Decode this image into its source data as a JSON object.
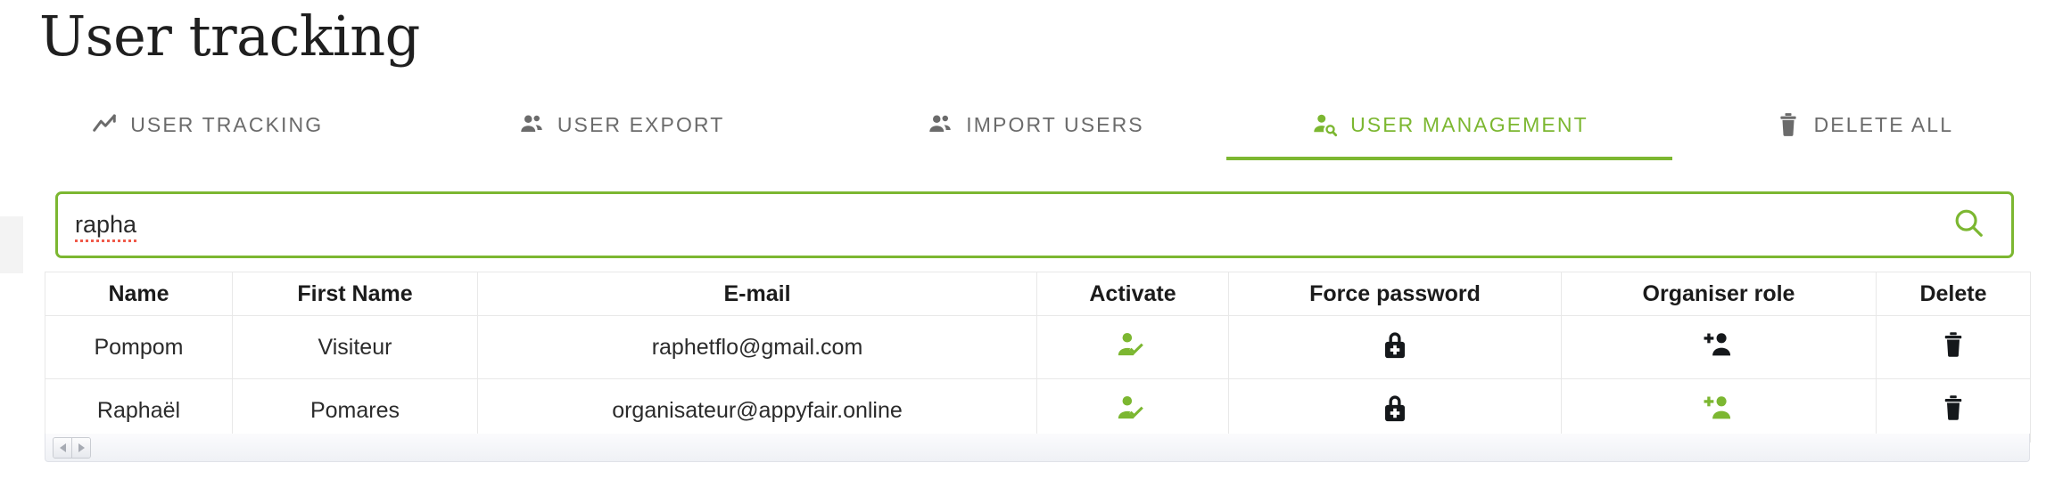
{
  "page": {
    "title": "User tracking"
  },
  "tabs": [
    {
      "label": "USER TRACKING",
      "icon": "trend-line-icon",
      "active": false
    },
    {
      "label": "USER EXPORT",
      "icon": "people-icon",
      "active": false
    },
    {
      "label": "IMPORT USERS",
      "icon": "people-icon",
      "active": false
    },
    {
      "label": "USER MANAGEMENT",
      "icon": "person-search-icon",
      "active": true
    },
    {
      "label": "DELETE ALL",
      "icon": "trash-icon",
      "active": false
    }
  ],
  "search": {
    "value": "rapha",
    "placeholder": "",
    "button_icon": "search-icon"
  },
  "table": {
    "headers": [
      "Name",
      "First Name",
      "E-mail",
      "Activate",
      "Force password",
      "Organiser role",
      "Delete"
    ],
    "rows": [
      {
        "name": "Pompom",
        "first_name": "Visiteur",
        "email": "raphetflo@gmail.com",
        "activate_icon": "person-check-icon",
        "activate_color": "#7cb731",
        "force_password_icon": "lock-plus-icon",
        "force_password_color": "#15181b",
        "organiser_icon": "person-add-icon",
        "organiser_color": "#15181b",
        "delete_icon": "trash-icon",
        "delete_color": "#15181b"
      },
      {
        "name": "Raphaël",
        "first_name": "Pomares",
        "email": "organisateur@appyfair.online",
        "activate_icon": "person-check-icon",
        "activate_color": "#7cb731",
        "force_password_icon": "lock-plus-icon",
        "force_password_color": "#15181b",
        "organiser_icon": "person-add-icon",
        "organiser_color": "#7cb731",
        "delete_icon": "trash-icon",
        "delete_color": "#15181b"
      }
    ]
  },
  "pagination": {
    "prev_icon": "triangle-left-icon",
    "next_icon": "triangle-right-icon"
  },
  "colors": {
    "accent_green": "#7cb731",
    "text_dark": "#1b1b1b",
    "text_muted": "#6b6b6b",
    "spellcheck_red": "#f05a4a"
  }
}
